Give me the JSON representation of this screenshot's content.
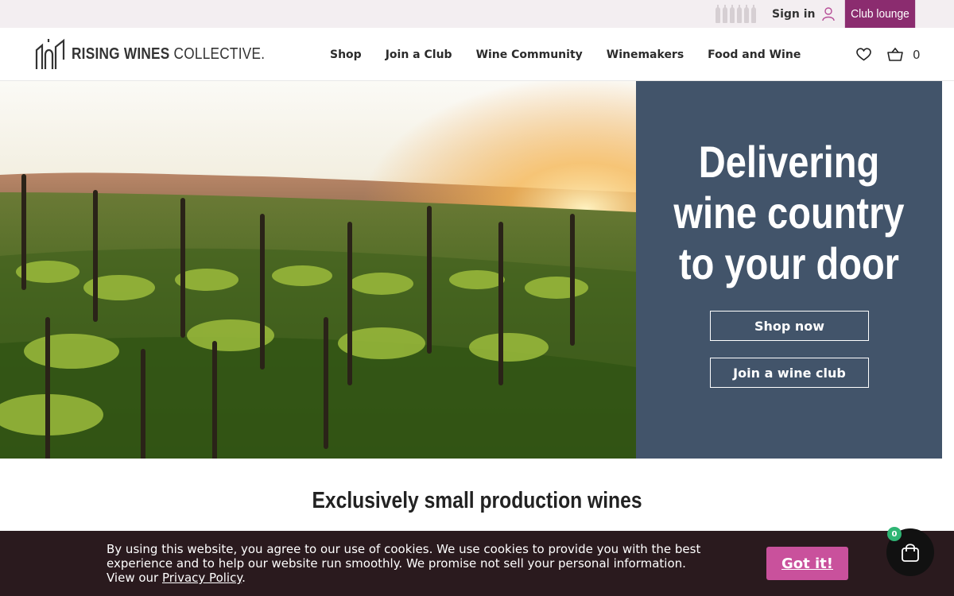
{
  "topbar": {
    "signin_label": "Sign in",
    "club_lounge_label": "Club lounge"
  },
  "header": {
    "logo_bold": "RISING WINES",
    "logo_light": " COLLECTIVE.",
    "nav": [
      {
        "label": "Shop"
      },
      {
        "label": "Join a Club"
      },
      {
        "label": "Wine Community"
      },
      {
        "label": "Winemakers"
      },
      {
        "label": "Food and Wine"
      }
    ],
    "cart_count": "0"
  },
  "hero": {
    "title": "Delivering wine country to your door",
    "shop_now_label": "Shop now",
    "join_club_label": "Join a wine club"
  },
  "section": {
    "title": "Exclusively small production wines"
  },
  "cookie": {
    "text": "By using this website, you agree to our use of cookies. We use cookies to provide you with the best experience and to help our website run smoothly. We promise not sell your personal information.",
    "view_prefix": "View our ",
    "privacy_link": "Privacy Policy",
    "suffix": ".",
    "accept_label": "Got it!"
  },
  "floating_cart": {
    "badge": "0"
  },
  "colors": {
    "brand_plum": "#8b2c6f",
    "panel_slate": "#42546a",
    "cookie_bg": "#2a1a1e",
    "accept_pink": "#c9519c",
    "badge_green": "#2fb574"
  }
}
